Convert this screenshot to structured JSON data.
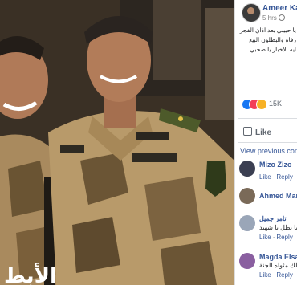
{
  "post": {
    "author": "Ameer Kam",
    "time": "5 hrs",
    "text_lines": [
      "يا حبيبي بعد اذان الفجر",
      "رفاه والبطلون البيع",
      "ايه الاخبار يا صحبي"
    ],
    "reactions_count": "15K",
    "like_label": "Like",
    "view_previous": "View previous comme"
  },
  "comments": [
    {
      "name": "Mizo Zizo",
      "text": "",
      "actions": [
        "Like",
        "Reply"
      ]
    },
    {
      "name": "Ahmed Mam",
      "text": "",
      "actions": []
    },
    {
      "name": "تامر جميل",
      "text": "ياه يا بطل يا شهيد",
      "actions": [
        "Like",
        "Reply"
      ]
    },
    {
      "name": "Magda Elsaf",
      "text": "ربنا يدخلك مثواه الجنة",
      "actions": [
        "Like",
        "Reply"
      ]
    }
  ],
  "photo": {
    "caption_fragment": "الأبط"
  },
  "colors": {
    "link": "#385898",
    "like_blue": "#1877f2",
    "love_red": "#f33e58",
    "wow_yellow": "#f7b125"
  },
  "icons": [
    "globe-icon",
    "like-reaction-icon",
    "love-reaction-icon",
    "wow-reaction-icon",
    "thumbs-up-icon"
  ]
}
